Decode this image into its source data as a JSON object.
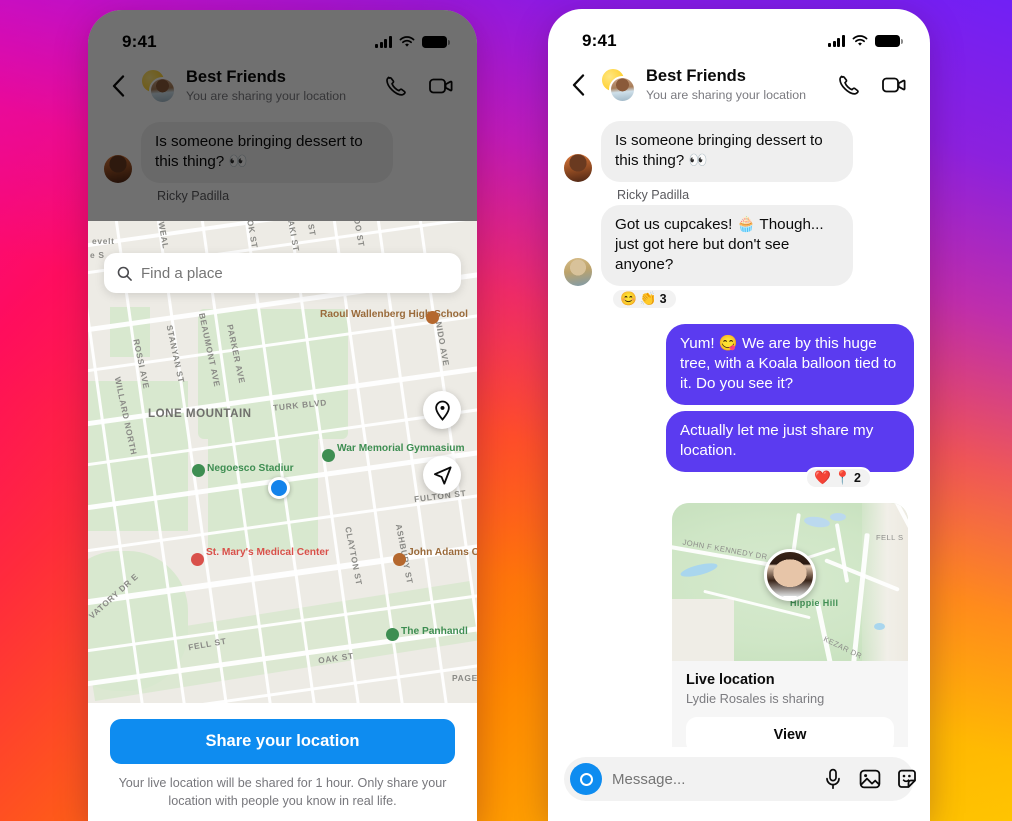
{
  "background": {
    "gradient_colors": [
      "#F000A8",
      "#FF0A5E",
      "#FF5A1A",
      "#FFC800",
      "#6E1EFA"
    ]
  },
  "theme": {
    "accent_blue": "#0E8CF0",
    "bubble_out": "#5B3BF0",
    "bubble_in": "#EFEFEF",
    "map_green": "#3E8E52"
  },
  "left_phone": {
    "status_bar": {
      "time": "9:41",
      "signal_icon": "cellular-bars-icon",
      "wifi_icon": "wifi-icon",
      "battery_icon": "battery-icon"
    },
    "header": {
      "back_icon": "chevron-left-icon",
      "avatar": "group-avatar",
      "title": "Best Friends",
      "subtitle": "You are sharing your location",
      "call_icon": "phone-icon",
      "video_icon": "video-camera-icon"
    },
    "messages": [
      {
        "id": "m1",
        "direction": "in",
        "text": "Is someone bringing dessert to this thing? 👀",
        "avatar": "avatar-ricky"
      }
    ],
    "sender_label": "Ricky Padilla",
    "map": {
      "search_placeholder": "Find a place",
      "search_icon": "search-icon",
      "recenter_icon": "location-pin-icon",
      "navigate_icon": "navigate-arrow-icon",
      "labels": [
        "evelt",
        "e S",
        "NWEAL",
        "OK ST",
        "AKI ST",
        "ST",
        "IDO ST",
        "Raoul Wallenberg High School",
        "STANYAN ST",
        "BEAUMONT AVE",
        "PARKER AVE",
        "ROSSI AVE",
        "NIDO AVE",
        "TURK BLVD",
        "LONE MOUNTAIN",
        "WILLARD NORTH",
        "Negoesco Stadiur",
        "War Memorial Gymnasium",
        "FULTON ST",
        "CLAYTON ST",
        "ASHBURY ST",
        "St. Mary's Medical Center",
        "John Adams Center",
        "VATORY DR E",
        "FELL ST",
        "OAK ST",
        "The Panhandl",
        "PAGE"
      ]
    },
    "share": {
      "button_label": "Share your location",
      "note": "Your live location will be shared for 1 hour. Only share your location with people you know in real life."
    }
  },
  "right_phone": {
    "status_bar": {
      "time": "9:41",
      "signal_icon": "cellular-bars-icon",
      "wifi_icon": "wifi-icon",
      "battery_icon": "battery-icon"
    },
    "header": {
      "back_icon": "chevron-left-icon",
      "avatar": "group-avatar",
      "title": "Best Friends",
      "subtitle": "You are sharing your location",
      "call_icon": "phone-icon",
      "video_icon": "video-camera-icon"
    },
    "messages": [
      {
        "id": "r1",
        "direction": "in",
        "text": "Is someone bringing dessert to this thing? 👀"
      },
      {
        "id": "r2",
        "direction": "in",
        "text": "Got us cupcakes! 🧁 Though... just got here but don't see anyone?",
        "reactions": {
          "emojis": [
            "😊",
            "👏"
          ],
          "count": "3"
        }
      },
      {
        "id": "r3",
        "direction": "out",
        "text": "Yum! 😋 We are by this huge tree, with a Koala balloon tied to it. Do you see it?"
      },
      {
        "id": "r4",
        "direction": "out",
        "text": "Actually let me just share my location.",
        "reactions": {
          "emojis": [
            "❤️",
            "📍"
          ],
          "count": "2"
        }
      }
    ],
    "sender_label": "Ricky Padilla",
    "location_card": {
      "title": "Live location",
      "subtitle": "Lydie Rosales is sharing",
      "view_label": "View",
      "map_labels": [
        "JOHN F KENNEDY DR",
        "FELL S",
        "Hippie Hill",
        "KEZAR DR"
      ],
      "pin_avatar": "lydie-avatar"
    },
    "composer": {
      "camera_icon": "camera-icon",
      "placeholder": "Message...",
      "mic_icon": "microphone-icon",
      "gallery_icon": "image-icon",
      "sticker_icon": "sticker-icon"
    }
  }
}
